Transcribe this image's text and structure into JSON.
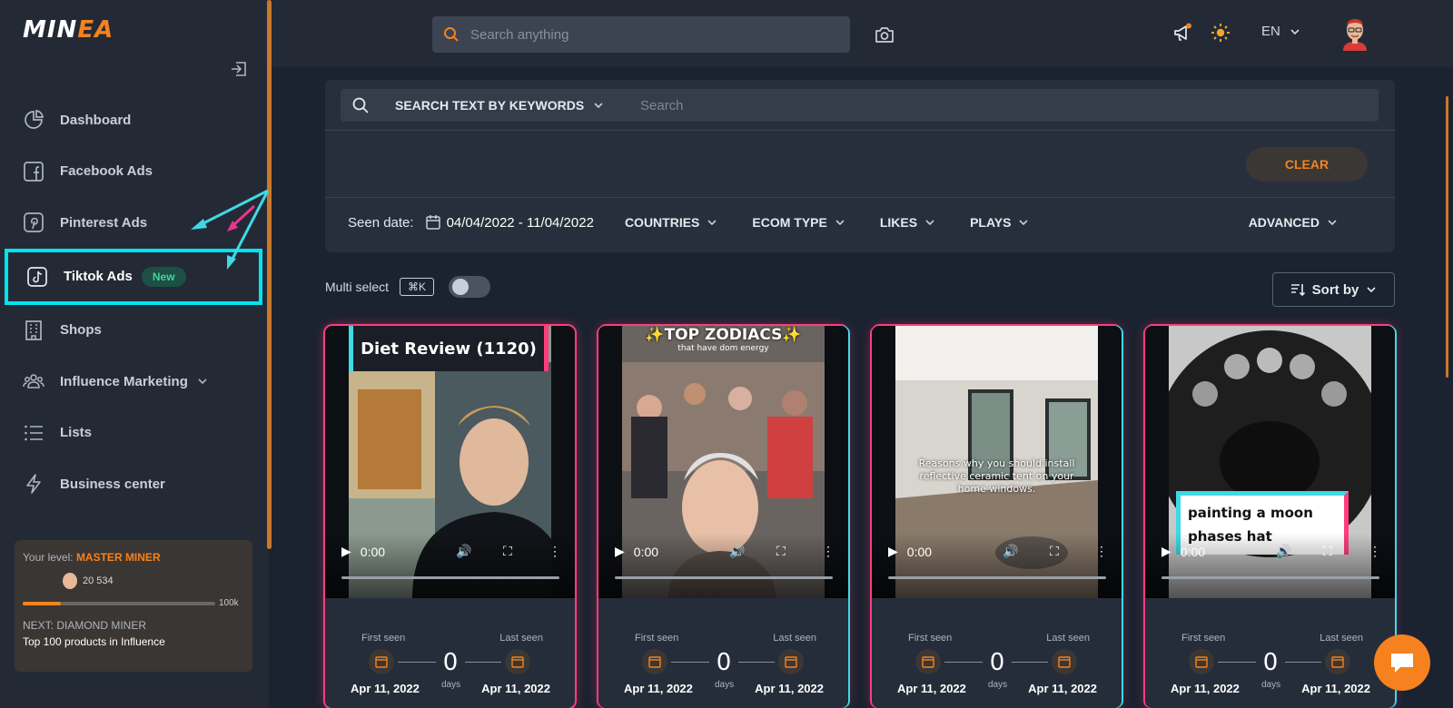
{
  "app": {
    "logo_text_1": "MIN",
    "logo_text_2": "EA"
  },
  "sidebar": {
    "items": [
      {
        "label": "Dashboard",
        "icon": "pie-chart-icon"
      },
      {
        "label": "Facebook Ads",
        "icon": "facebook-icon"
      },
      {
        "label": "Pinterest Ads",
        "icon": "pinterest-icon"
      },
      {
        "label": "Tiktok Ads",
        "icon": "tiktok-icon",
        "badge": "New",
        "active": true
      },
      {
        "label": "Shops",
        "icon": "building-icon"
      },
      {
        "label": "Influence Marketing",
        "icon": "people-icon"
      },
      {
        "label": "Lists",
        "icon": "list-icon"
      },
      {
        "label": "Business center",
        "icon": "lightning-icon"
      }
    ],
    "level": {
      "label": "Your level:",
      "rank": "MASTER MINER",
      "points": "20 534",
      "progress_fraction": 0.2,
      "max": "100k",
      "next": "NEXT: DIAMOND MINER",
      "next_desc": "Top 100 products in Influence"
    }
  },
  "topbar": {
    "search_placeholder": "Search anything",
    "language": "EN"
  },
  "filters": {
    "keyword_mode": "SEARCH TEXT BY KEYWORDS",
    "keyword_placeholder": "Search",
    "clear_label": "CLEAR",
    "seen_date_label": "Seen date:",
    "seen_date_range": "04/04/2022 - 11/04/2022",
    "countries": "COUNTRIES",
    "ecom_type": "ECOM TYPE",
    "likes": "LIKES",
    "plays": "PLAYS",
    "advanced": "ADVANCED"
  },
  "list_controls": {
    "multi_select": "Multi select",
    "shortcut": "⌘K",
    "sort_by": "Sort by"
  },
  "cards": [
    {
      "overlay": "Diet Review (1120)",
      "time": "0:00",
      "first_seen_label": "First seen",
      "last_seen_label": "Last seen",
      "days": "0",
      "days_label": "days",
      "first_seen": "Apr 11, 2022",
      "last_seen": "Apr 11, 2022"
    },
    {
      "overlay": "✨TOP ZODIACS✨",
      "overlay_sub": "that have dom energy",
      "time": "0:00",
      "first_seen_label": "First seen",
      "last_seen_label": "Last seen",
      "days": "0",
      "days_label": "days",
      "first_seen": "Apr 11, 2022",
      "last_seen": "Apr 11, 2022"
    },
    {
      "overlay": "Reasons why you should install reflective ceramic tent on your home windows.",
      "time": "0:00",
      "first_seen_label": "First seen",
      "last_seen_label": "Last seen",
      "days": "0",
      "days_label": "days",
      "first_seen": "Apr 11, 2022",
      "last_seen": "Apr 11, 2022"
    },
    {
      "overlay": "painting a moon phases hat",
      "time": "0:00",
      "first_seen_label": "First seen",
      "last_seen_label": "Last seen",
      "days": "0",
      "days_label": "days",
      "first_seen": "Apr 11, 2022",
      "last_seen": "Apr 11, 2022"
    }
  ],
  "colors": {
    "accent": "#f5821f",
    "highlight": "#00e5f0",
    "badge_green": "#3fd39a"
  }
}
